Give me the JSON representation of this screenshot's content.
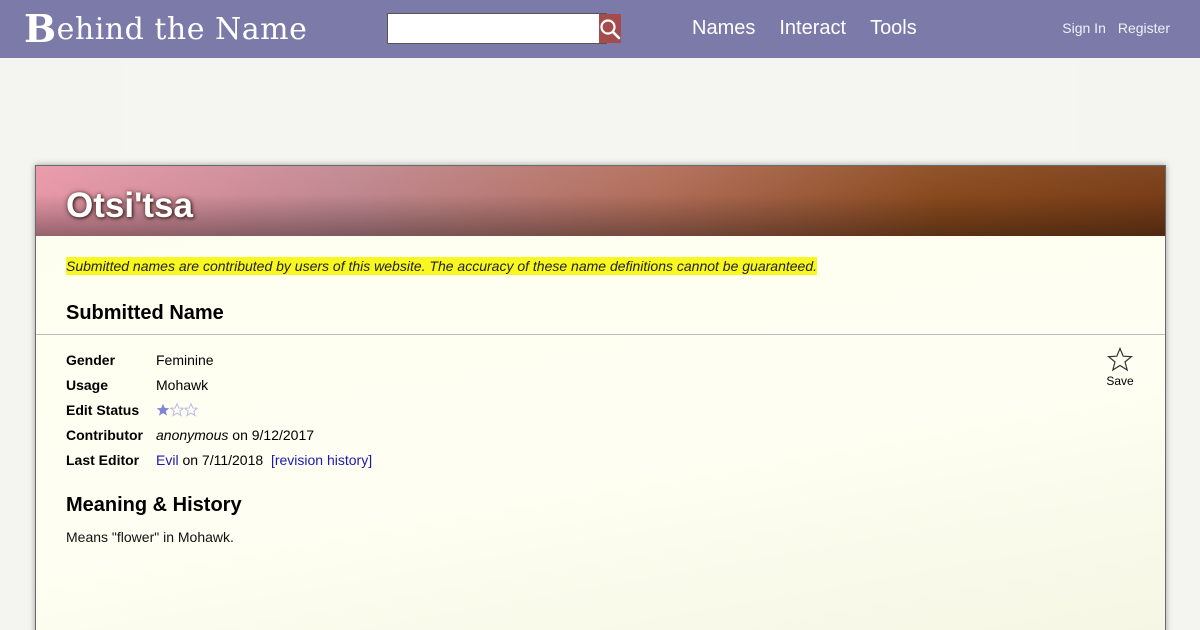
{
  "header": {
    "logo_initial": "B",
    "logo_rest": "ehind the Name",
    "search": {
      "value": "",
      "placeholder": ""
    },
    "nav": [
      "Names",
      "Interact",
      "Tools"
    ],
    "user_nav": [
      "Sign In",
      "Register"
    ]
  },
  "name": {
    "title": "Otsi'tsa",
    "disclaimer": "Submitted names are contributed by users of this website. The accuracy of these name definitions cannot be guaranteed.",
    "section_title": "Submitted Name",
    "info": {
      "gender_label": "Gender",
      "gender_value": "Feminine",
      "usage_label": "Usage",
      "usage_value": "Mohawk",
      "edit_status_label": "Edit Status",
      "edit_status_stars": 1,
      "edit_status_max": 3,
      "contributor_label": "Contributor",
      "contributor_name": "anonymous",
      "contributor_on": " on 9/12/2017",
      "last_editor_label": "Last Editor",
      "last_editor_name": "Evil",
      "last_editor_on": " on 7/11/2018",
      "revision_history": "[revision history]"
    },
    "save_label": "Save",
    "meaning_title": "Meaning & History",
    "meaning_text": "Means \"flower\" in Mohawk."
  },
  "colors": {
    "topbar": "#7b7aa9",
    "search_button": "#a44b4b",
    "highlight": "#f8f820",
    "star_filled": "#7e84d6",
    "star_empty": "#b9bce6"
  }
}
